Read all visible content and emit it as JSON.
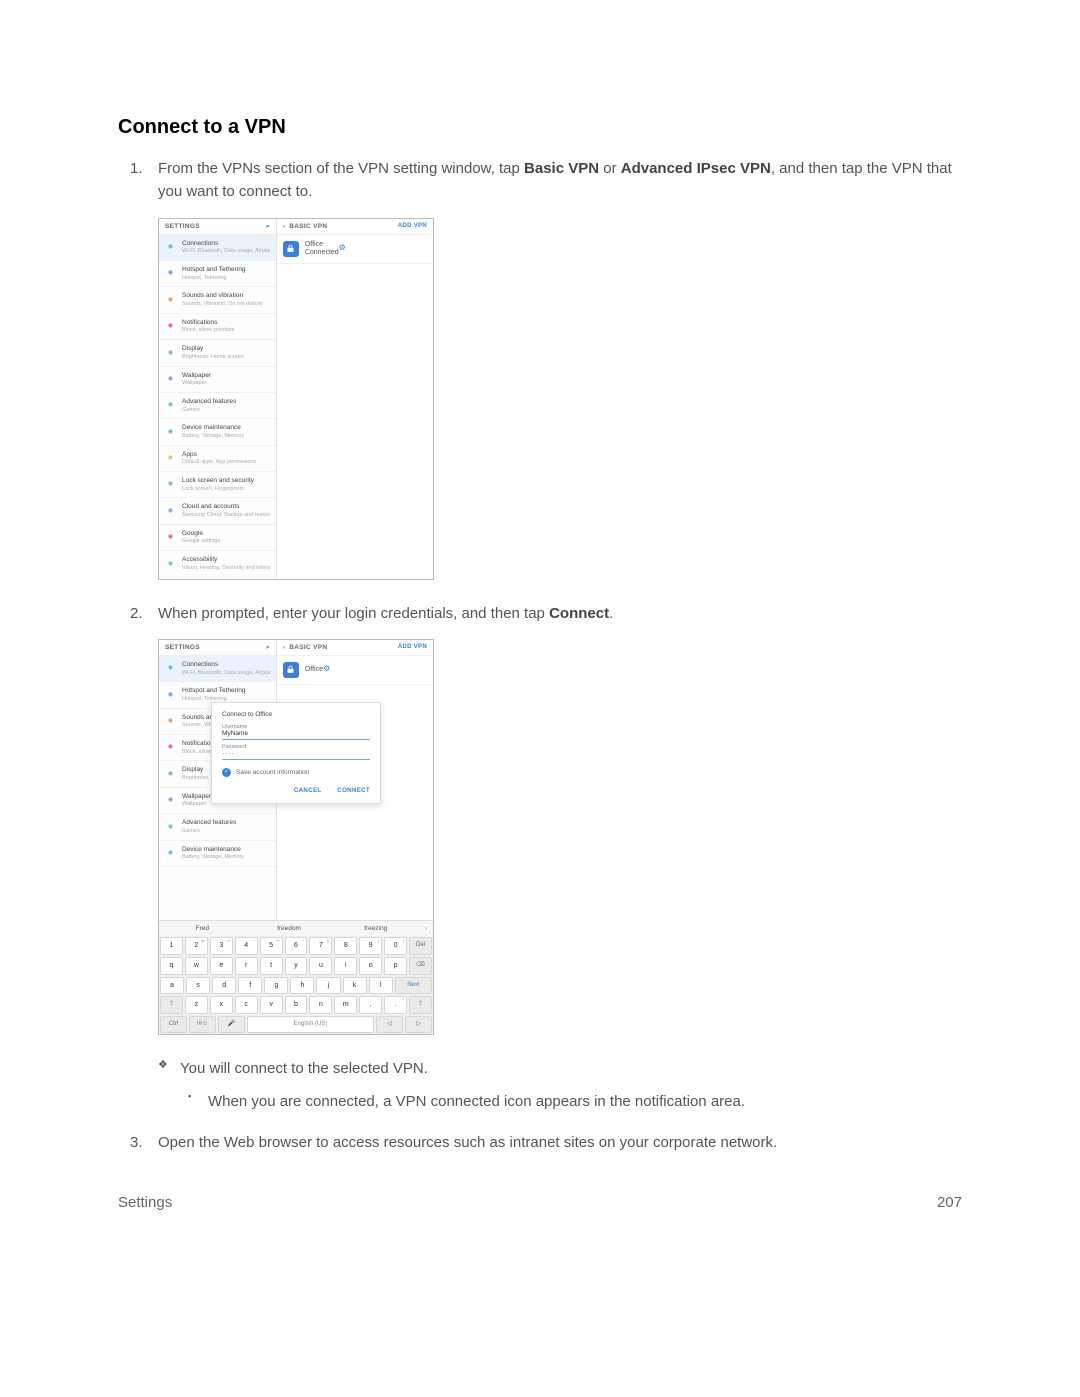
{
  "heading": "Connect to a VPN",
  "steps": {
    "s1_a": "From the VPNs section of the VPN setting window, tap ",
    "s1_b1": "Basic VPN",
    "s1_c": " or ",
    "s1_b2": "Advanced IPsec VPN",
    "s1_d": ", and then tap the VPN that you want to connect to.",
    "s2_a": "When prompted, enter your login credentials, and then tap ",
    "s2_b": "Connect",
    "s2_c": ".",
    "s3": "Open the Web browser to access resources such as intranet sites on your corporate network."
  },
  "bullets": {
    "b1": "You will connect to the selected VPN.",
    "b2": "When you are connected, a VPN connected icon appears in the notification area."
  },
  "footer": {
    "section": "Settings",
    "page": "207"
  },
  "shot": {
    "settings_title": "SETTINGS",
    "basic_vpn": "BASIC VPN",
    "add_vpn": "ADD VPN",
    "items": [
      {
        "l": "Connections",
        "s": "Wi-Fi, Bluetooth, Data usage, Airplane m..."
      },
      {
        "l": "Hotspot and Tethering",
        "s": "Hotspot, Tethering"
      },
      {
        "l": "Sounds and vibration",
        "s": "Sounds, Vibration, Do not disturb"
      },
      {
        "l": "Notifications",
        "s": "Block, allow, prioritize"
      },
      {
        "l": "Display",
        "s": "Brightness, Home screen"
      },
      {
        "l": "Wallpaper",
        "s": "Wallpaper"
      },
      {
        "l": "Advanced features",
        "s": "Games"
      },
      {
        "l": "Device maintenance",
        "s": "Battery, Storage, Memory"
      },
      {
        "l": "Apps",
        "s": "Default apps, App permissions"
      },
      {
        "l": "Lock screen and security",
        "s": "Lock screen, Fingerprints"
      },
      {
        "l": "Cloud and accounts",
        "s": "Samsung Cloud, Backup and restore"
      },
      {
        "l": "Google",
        "s": "Google settings"
      },
      {
        "l": "Accessibility",
        "s": "Vision, Hearing, Dexterity and interaction"
      }
    ],
    "vpn": {
      "name": "Office",
      "status": "Connected"
    },
    "vpn2_name": "Office",
    "dialog": {
      "title": "Connect to Office",
      "un_label": "Username",
      "un_value": "MyName",
      "pw_label": "Password",
      "pw_value": "····",
      "save": "Save account information",
      "cancel": "CANCEL",
      "connect": "CONNECT"
    },
    "suggest": [
      "Fred",
      "freedom",
      "freezing"
    ],
    "kbd": {
      "row1": [
        {
          "k": "1"
        },
        {
          "k": "2",
          "s": "@"
        },
        {
          "k": "3",
          "s": "#"
        },
        {
          "k": "4",
          "s": "/"
        },
        {
          "k": "5",
          "s": "%"
        },
        {
          "k": "6",
          "s": "^"
        },
        {
          "k": "7",
          "s": "&"
        },
        {
          "k": "8",
          "s": "*"
        },
        {
          "k": "9",
          "s": "("
        },
        {
          "k": "0",
          "s": ")"
        },
        {
          "k": "Del",
          "fn": true
        }
      ],
      "row2": [
        {
          "k": "q"
        },
        {
          "k": "w"
        },
        {
          "k": "e"
        },
        {
          "k": "r"
        },
        {
          "k": "t"
        },
        {
          "k": "y"
        },
        {
          "k": "u"
        },
        {
          "k": "i"
        },
        {
          "k": "o"
        },
        {
          "k": "p"
        },
        {
          "k": "⌫",
          "fn": true
        }
      ],
      "row3": [
        {
          "k": "a"
        },
        {
          "k": "s"
        },
        {
          "k": "d"
        },
        {
          "k": "f"
        },
        {
          "k": "g"
        },
        {
          "k": "h"
        },
        {
          "k": "j"
        },
        {
          "k": "k"
        },
        {
          "k": "l"
        },
        {
          "k": "Next",
          "fn": true,
          "next": true
        }
      ],
      "row4": [
        {
          "k": "⇧",
          "fn": true
        },
        {
          "k": "z"
        },
        {
          "k": "x"
        },
        {
          "k": "c"
        },
        {
          "k": "v"
        },
        {
          "k": "b"
        },
        {
          "k": "n"
        },
        {
          "k": "m"
        },
        {
          "k": ",",
          "s": "!"
        },
        {
          "k": ".",
          "s": "?"
        },
        {
          "k": "⇧",
          "fn": true
        }
      ],
      "row5": [
        {
          "k": "Ctrl",
          "fn": true
        },
        {
          "k": "!#☺",
          "fn": true
        },
        {
          "k": "🎤",
          "fn": true
        },
        {
          "k": "English (US)",
          "space": true
        },
        {
          "k": "◁",
          "fn": true
        },
        {
          "k": "▷",
          "fn": true
        }
      ]
    },
    "icon_colors": [
      "#4db6e2",
      "#5c95e6",
      "#e38f4f",
      "#e05a6a",
      "#66c27a",
      "#a47fe0",
      "#5cc2c9",
      "#4db6e2",
      "#e6b84f",
      "#6fbf8a",
      "#6aa7e6",
      "#e05a6a",
      "#5cc2c9"
    ]
  }
}
